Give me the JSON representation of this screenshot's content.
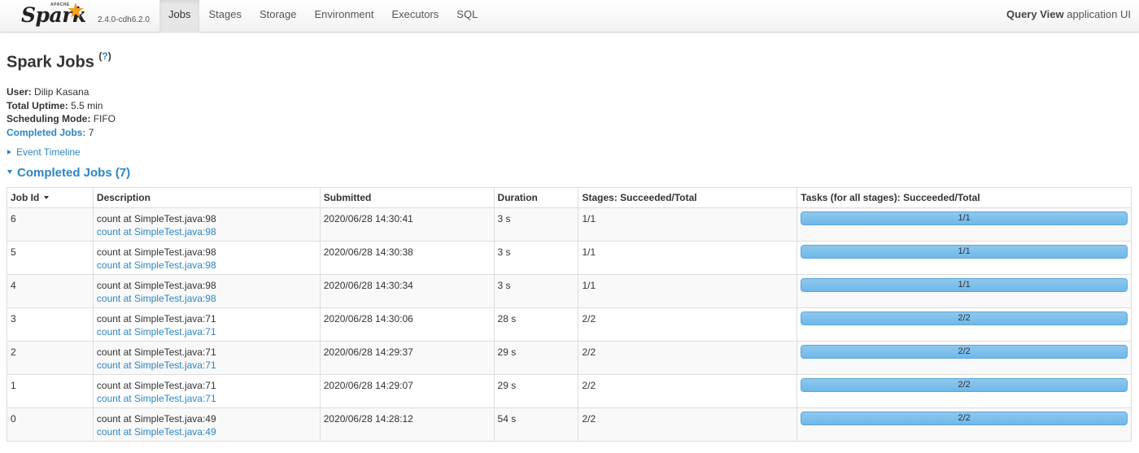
{
  "navbar": {
    "brand_apache": "APACHE",
    "brand_spark": "Spark",
    "version": "2.4.0-cdh6.2.0",
    "tabs": [
      {
        "label": "Jobs",
        "active": true
      },
      {
        "label": "Stages",
        "active": false
      },
      {
        "label": "Storage",
        "active": false
      },
      {
        "label": "Environment",
        "active": false
      },
      {
        "label": "Executors",
        "active": false
      },
      {
        "label": "SQL",
        "active": false
      }
    ],
    "app_name": "Query View",
    "app_suffix": "application UI"
  },
  "page": {
    "title": "Spark Jobs",
    "help": "?"
  },
  "summary": {
    "user_label": "User:",
    "user_value": "Dilip Kasana",
    "uptime_label": "Total Uptime:",
    "uptime_value": "5.5 min",
    "mode_label": "Scheduling Mode:",
    "mode_value": "FIFO",
    "completed_label": "Completed Jobs:",
    "completed_value": "7"
  },
  "event_timeline": "Event Timeline",
  "completed_section": "Completed Jobs (7)",
  "table": {
    "headers": [
      "Job Id",
      "Description",
      "Submitted",
      "Duration",
      "Stages: Succeeded/Total",
      "Tasks (for all stages): Succeeded/Total"
    ],
    "rows": [
      {
        "id": "6",
        "desc": "count at SimpleTest.java:98",
        "link": "count at SimpleTest.java:98",
        "submitted": "2020/06/28 14:30:41",
        "duration": "3 s",
        "stages": "1/1",
        "tasks": "1/1",
        "progress": 1.0
      },
      {
        "id": "5",
        "desc": "count at SimpleTest.java:98",
        "link": "count at SimpleTest.java:98",
        "submitted": "2020/06/28 14:30:38",
        "duration": "3 s",
        "stages": "1/1",
        "tasks": "1/1",
        "progress": 1.0
      },
      {
        "id": "4",
        "desc": "count at SimpleTest.java:98",
        "link": "count at SimpleTest.java:98",
        "submitted": "2020/06/28 14:30:34",
        "duration": "3 s",
        "stages": "1/1",
        "tasks": "1/1",
        "progress": 1.0
      },
      {
        "id": "3",
        "desc": "count at SimpleTest.java:71",
        "link": "count at SimpleTest.java:71",
        "submitted": "2020/06/28 14:30:06",
        "duration": "28 s",
        "stages": "2/2",
        "tasks": "2/2",
        "progress": 1.0
      },
      {
        "id": "2",
        "desc": "count at SimpleTest.java:71",
        "link": "count at SimpleTest.java:71",
        "submitted": "2020/06/28 14:29:37",
        "duration": "29 s",
        "stages": "2/2",
        "tasks": "2/2",
        "progress": 1.0
      },
      {
        "id": "1",
        "desc": "count at SimpleTest.java:71",
        "link": "count at SimpleTest.java:71",
        "submitted": "2020/06/28 14:29:07",
        "duration": "29 s",
        "stages": "2/2",
        "tasks": "2/2",
        "progress": 1.0
      },
      {
        "id": "0",
        "desc": "count at SimpleTest.java:49",
        "link": "count at SimpleTest.java:49",
        "submitted": "2020/06/28 14:28:12",
        "duration": "54 s",
        "stages": "2/2",
        "tasks": "2/2",
        "progress": 1.0
      }
    ]
  },
  "colors": {
    "link": "#2b86c5",
    "progress_bar": "#7cbfec"
  },
  "icons": {
    "brand_star": "star-icon",
    "sort": "caret-down-icon",
    "timeline_toggle": "arrow-right-icon",
    "section_toggle": "arrow-down-icon"
  }
}
